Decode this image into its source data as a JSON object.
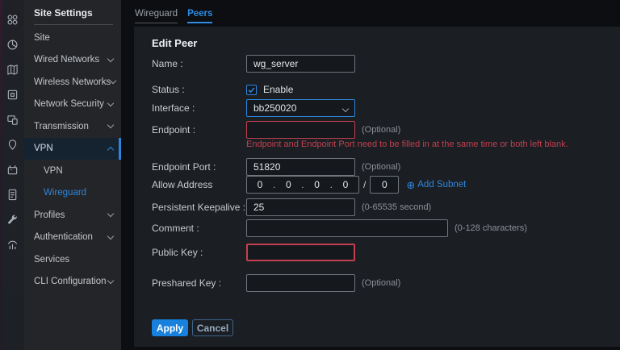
{
  "colors": {
    "accent": "#2e86dc",
    "error": "#c2404f",
    "apply_button": "#1781dd"
  },
  "icon_rail": {
    "icons": [
      "dashboard-icon",
      "statistics-icon",
      "map-icon",
      "devices-icon",
      "clients-icon",
      "location-icon",
      "insight-icon",
      "log-icon",
      "toolkit-icon",
      "report-icon"
    ]
  },
  "sidebar": {
    "title": "Site Settings",
    "items": [
      {
        "label": "Site"
      },
      {
        "label": "Wired Networks",
        "expandable": true
      },
      {
        "label": "Wireless Networks",
        "expandable": true
      },
      {
        "label": "Network Security",
        "expandable": true
      },
      {
        "label": "Transmission",
        "expandable": true
      },
      {
        "label": "VPN",
        "expandable": true,
        "expanded": true,
        "active": true
      },
      {
        "label": "VPN",
        "sub": true
      },
      {
        "label": "Wireguard",
        "sub": true,
        "selected": true
      },
      {
        "label": "Profiles",
        "expandable": true
      },
      {
        "label": "Authentication",
        "expandable": true
      },
      {
        "label": "Services"
      },
      {
        "label": "CLI Configuration",
        "expandable": true
      }
    ]
  },
  "tabs": [
    {
      "label": "Wireguard",
      "active": false
    },
    {
      "label": "Peers",
      "active": true
    }
  ],
  "panel": {
    "title": "Edit Peer",
    "fields": {
      "name": {
        "label": "Name :",
        "value": "wg_server"
      },
      "status": {
        "label": "Status :",
        "checkbox_label": "Enable",
        "checked": true
      },
      "interface": {
        "label": "Interface :",
        "value": "bb250020"
      },
      "endpoint": {
        "label": "Endpoint :",
        "value": "",
        "hint": "(Optional)",
        "error": "Endpoint and Endpoint Port need to be filled in at the same time or both left blank."
      },
      "endpoint_port": {
        "label": "Endpoint Port :",
        "value": "51820",
        "hint": "(Optional)"
      },
      "allow_address": {
        "label": "Allow Address",
        "octet1": "0",
        "octet2": "0",
        "octet3": "0",
        "octet4": "0",
        "separator": "/",
        "prefix": "0",
        "add_subnet_label": "Add Subnet",
        "add_subnet_icon": "⊕"
      },
      "persistent_keepalive": {
        "label": "Persistent Keepalive :",
        "value": "25",
        "hint": "(0-65535 second)"
      },
      "comment": {
        "label": "Comment :",
        "value": "",
        "hint": "(0-128 characters)"
      },
      "public_key": {
        "label": "Public Key :",
        "value": ""
      },
      "preshared_key": {
        "label": "Preshared Key :",
        "value": "",
        "hint": "(Optional)"
      }
    },
    "buttons": {
      "apply": "Apply",
      "cancel": "Cancel"
    }
  }
}
